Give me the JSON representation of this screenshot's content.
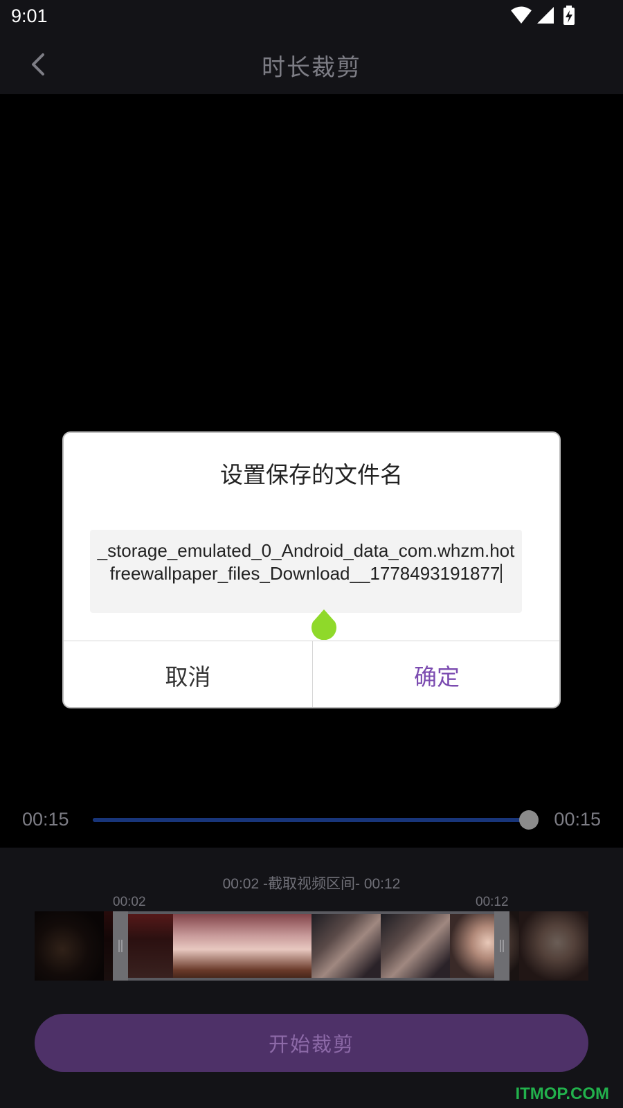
{
  "status_bar": {
    "time": "9:01",
    "icons": [
      "wifi-icon",
      "signal-icon",
      "battery-charging-icon"
    ]
  },
  "app_bar": {
    "back_icon": "chevron-left-icon",
    "title": "时长裁剪"
  },
  "player": {
    "current_time": "00:15",
    "total_time": "00:15",
    "progress": 1.0
  },
  "trim": {
    "range_caption": "00:02 -截取视频区间- 00:12",
    "start_marker": "00:02",
    "end_marker": "00:12"
  },
  "start_button": {
    "label": "开始裁剪"
  },
  "dialog": {
    "title": "设置保存的文件名",
    "filename_value": "_storage_emulated_0_Android_data_com.whzm.hotfreewallpaper_files_Download__1778493191877",
    "cancel_label": "取消",
    "confirm_label": "确定"
  },
  "watermark": "ITMOP.COM",
  "colors": {
    "accent_purple": "#7b4bb0",
    "button_bg": "#4e3168",
    "cursor_handle_green": "#8fd92a",
    "track_blue": "#1f3a7a"
  }
}
